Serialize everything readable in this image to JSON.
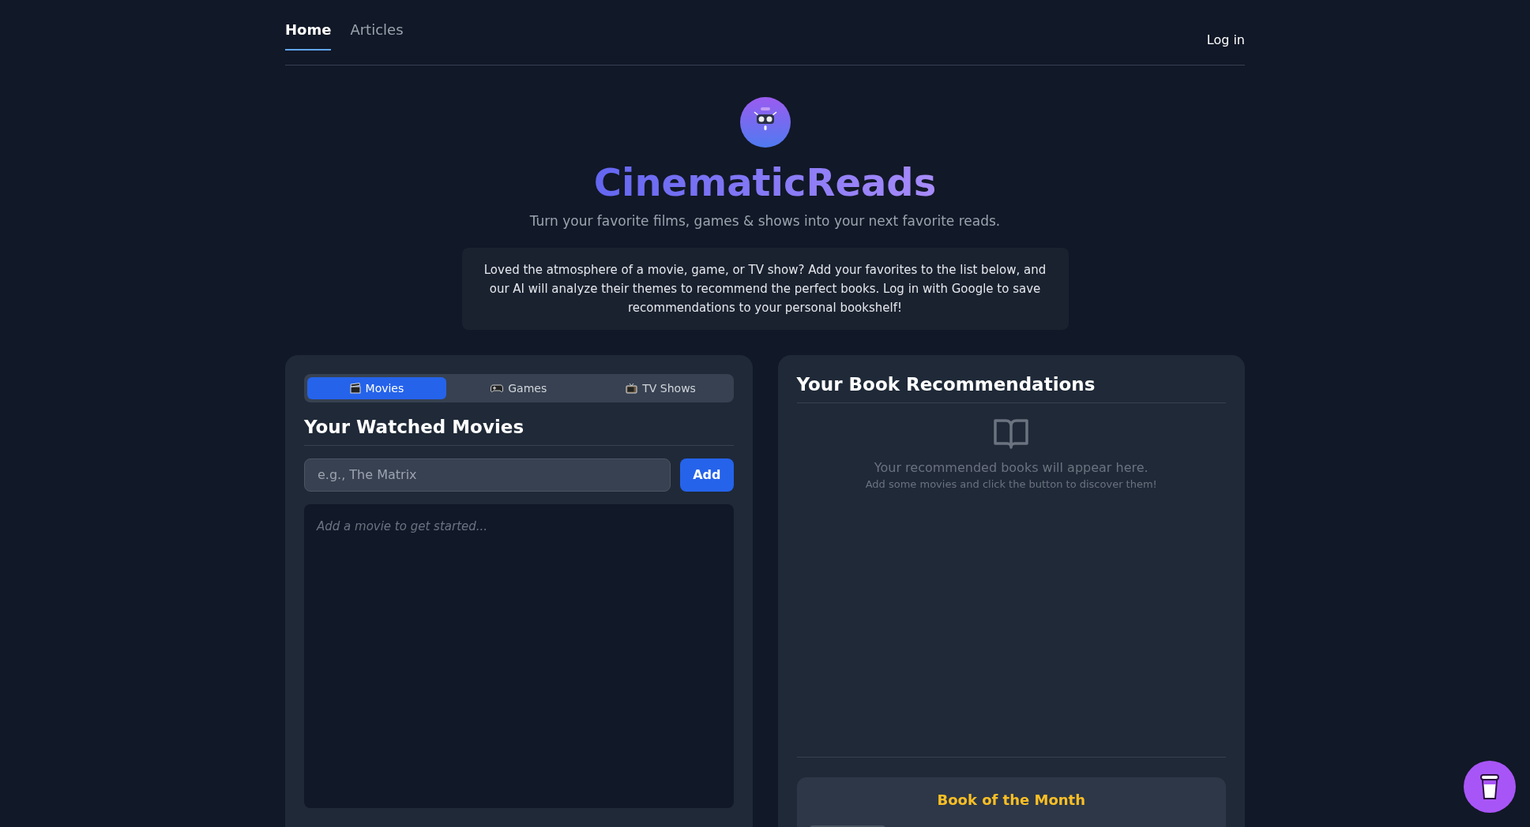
{
  "nav": {
    "links": [
      {
        "label": "Home",
        "selected": true
      },
      {
        "label": "Articles",
        "selected": false
      }
    ],
    "login": "Log in"
  },
  "hero": {
    "title": "CinematicReads",
    "subtitle": "Turn your favorite films, games & shows into your next favorite reads.",
    "intro": "Loved the atmosphere of a movie, game, or TV show? Add your favorites to the list below, and our AI will analyze their themes to recommend the perfect books. Log in with Google to save recommendations to your personal bookshelf!"
  },
  "media_panel": {
    "tabs": [
      {
        "kind": "movie",
        "label": "Movies",
        "selected": true
      },
      {
        "kind": "game",
        "label": "Games",
        "selected": false
      },
      {
        "kind": "tv",
        "label": "TV Shows",
        "selected": false
      }
    ],
    "heading": "Your Watched Movies",
    "input": {
      "placeholder": "e.g., The Matrix"
    },
    "add_button": "Add",
    "empty_text": "Add a movie to get started..."
  },
  "recommendations": {
    "heading": "Your Book Recommendations",
    "empty_title": "Your recommended books will appear here.",
    "empty_hint": "Add some movies and click the button to discover them!",
    "book_of_month": {
      "title": "Book of the Month"
    }
  }
}
